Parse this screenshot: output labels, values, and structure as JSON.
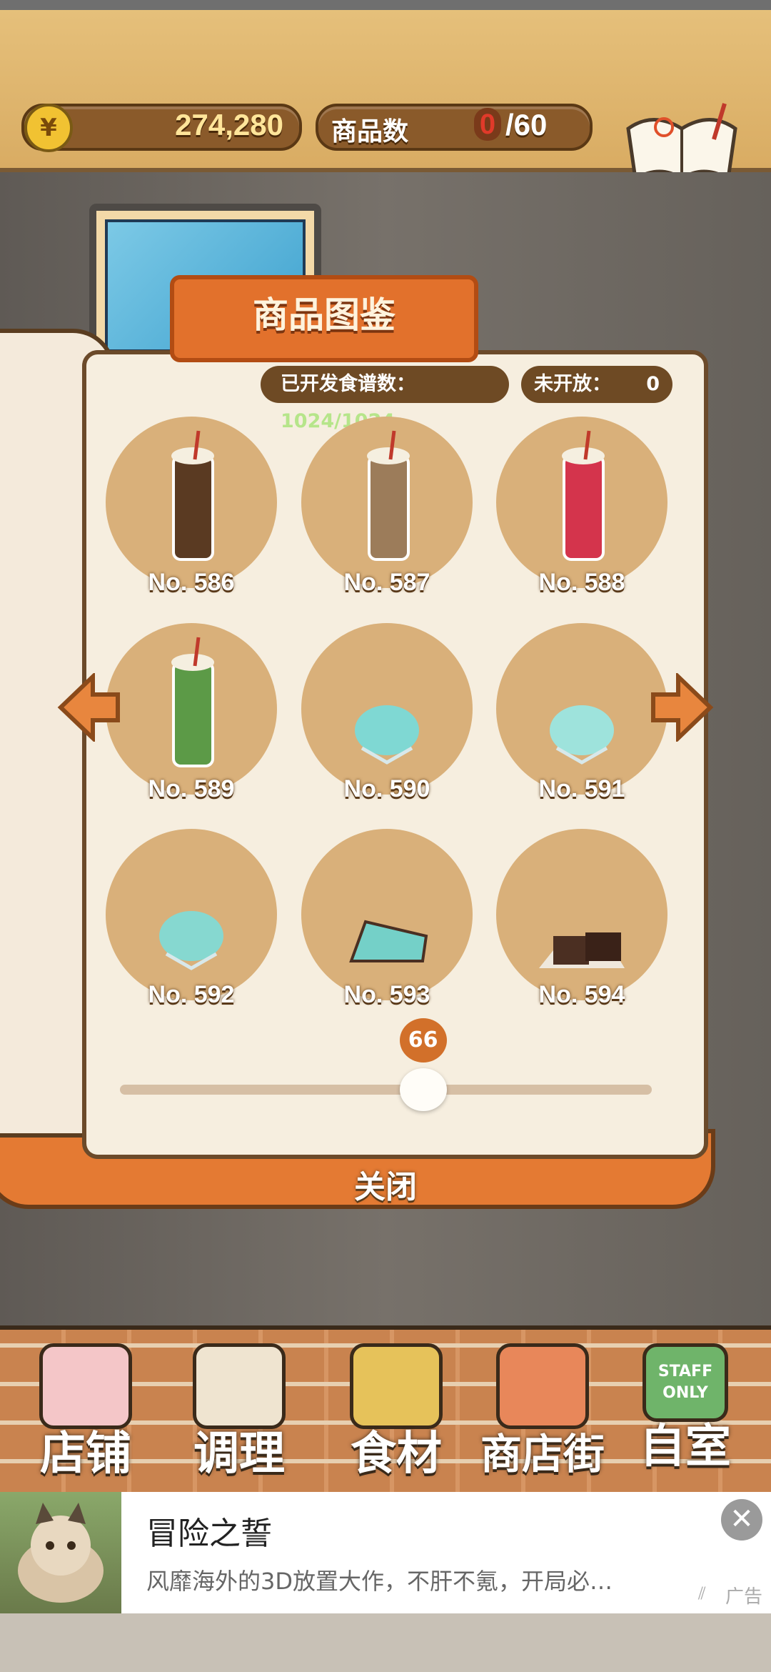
{
  "top_bar": {
    "currency_symbol": "¥",
    "money": "274,280",
    "product_count_label": "商品数",
    "product_count_current": "0",
    "product_count_max": "/60",
    "recipe_book_label": "食谱"
  },
  "catalog": {
    "title": "商品图鉴",
    "developed_label": "已开发食谱数：",
    "developed_value": "1024/1024",
    "unopened_label": "未开放：",
    "unopened_value": "0",
    "items": [
      {
        "label": "No. 586",
        "icon": "bubble-tea-icon",
        "color": "#5a3a22"
      },
      {
        "label": "No. 587",
        "icon": "milk-tea-icon",
        "color": "#9c7c5a"
      },
      {
        "label": "No. 588",
        "icon": "strawberry-drink-icon",
        "color": "#d4344c"
      },
      {
        "label": "No. 589",
        "icon": "matcha-drink-icon",
        "color": "#5c9a47"
      },
      {
        "label": "No. 590",
        "icon": "mint-icecream-icon",
        "color": "#7fd8d3"
      },
      {
        "label": "No. 591",
        "icon": "mint-parfait-icon",
        "color": "#9ee3dc"
      },
      {
        "label": "No. 592",
        "icon": "mint-scoop-icon",
        "color": "#86d8d0"
      },
      {
        "label": "No. 593",
        "icon": "mint-cake-icon",
        "color": "#74d0c8"
      },
      {
        "label": "No. 594",
        "icon": "brownie-icon",
        "color": "#4b2f22"
      }
    ],
    "page_value": "66",
    "page_fraction": 0.57,
    "close_label": "关闭"
  },
  "nav": {
    "items": [
      {
        "label": "店铺",
        "icon": "cake-icon"
      },
      {
        "label": "调理",
        "icon": "mixing-bowl-icon"
      },
      {
        "label": "食材",
        "icon": "flour-sack-icon"
      },
      {
        "label": "商店街",
        "icon": "shop-icon"
      },
      {
        "label": "自室",
        "icon": "staff-only-sign-icon",
        "sign_text": "STAFF ONLY"
      }
    ]
  },
  "ad": {
    "title": "冒险之誓",
    "description": "风靡海外的3D放置大作，不肝不氪，开局必…",
    "tag": "广告"
  },
  "colors": {
    "accent_orange": "#e2712c",
    "bar_brown": "#8a5a2a"
  }
}
